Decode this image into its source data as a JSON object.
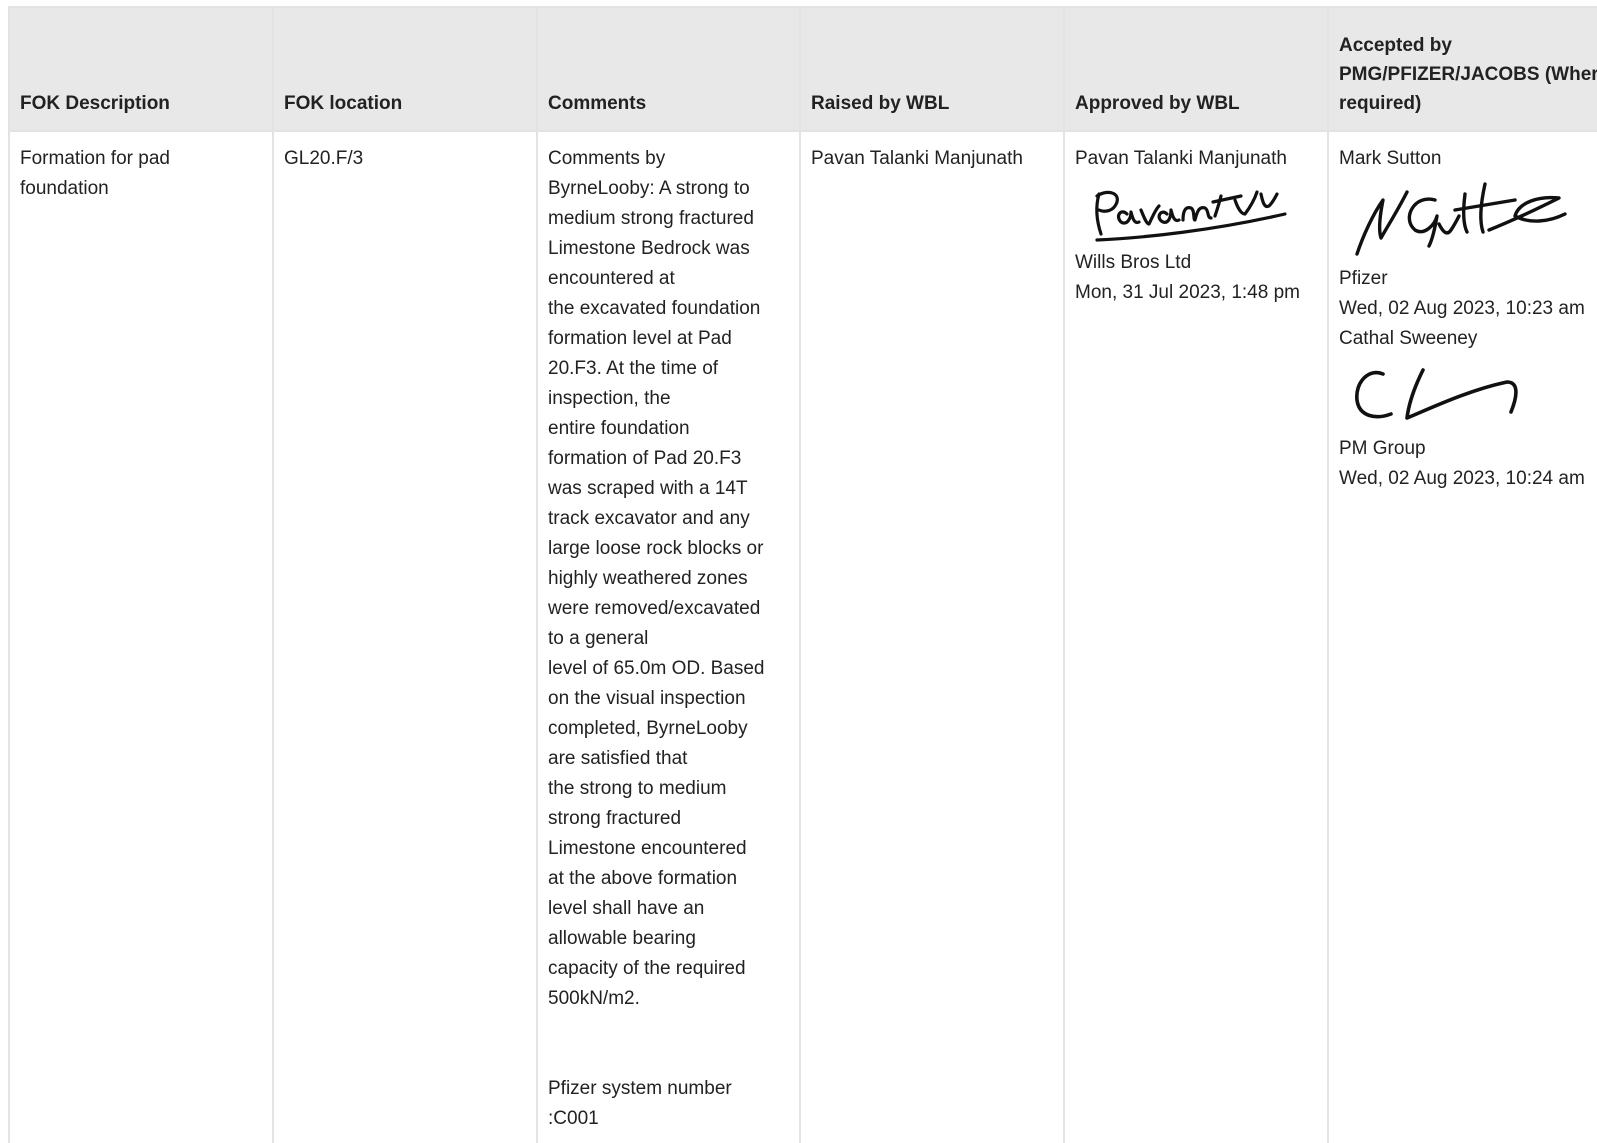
{
  "table": {
    "headers": {
      "description": "FOK Description",
      "location": "FOK location",
      "comments": "Comments",
      "raised": "Raised by WBL",
      "approved": "Approved by WBL",
      "accepted": "Accepted by PMG/PFIZER/JACOBS (Where required)"
    },
    "row": {
      "description": "Formation for pad foundation",
      "location": "GL20.F/3",
      "comments_lines": [
        "Comments by",
        "ByrneLooby: A strong to",
        "medium strong fractured",
        "Limestone Bedrock was",
        "encountered at",
        "the excavated foundation",
        "formation level at Pad",
        "20.F3. At the time of",
        "inspection, the",
        "entire foundation",
        "formation of Pad 20.F3",
        "was scraped with a 14T",
        "track excavator and any",
        "large loose rock blocks or",
        "highly weathered zones",
        "were removed/excavated",
        "to a general",
        "level of 65.0m OD. Based",
        "on the visual inspection",
        "completed, ByrneLooby",
        "are satisfied that",
        "the strong to medium",
        "strong fractured",
        "Limestone encountered",
        "at the above formation",
        "level shall have an",
        "allowable bearing",
        "capacity of the required",
        "500kN/m2."
      ],
      "system_number_lines": [
        "Pfizer system number",
        ":C001"
      ],
      "raised_by": "Pavan Talanki Manjunath",
      "approved": {
        "name": "Pavan Talanki Manjunath",
        "company": "Wills Bros Ltd",
        "date": "Mon, 31 Jul 2023, 1:48 pm"
      },
      "accepted": [
        {
          "name": "Mark Sutton",
          "company": "Pfizer",
          "date": "Wed, 02 Aug 2023, 10:23 am"
        },
        {
          "name": "Cathal Sweeney",
          "company": "PM Group",
          "date": "Wed, 02 Aug 2023, 10:24 am"
        }
      ]
    }
  }
}
